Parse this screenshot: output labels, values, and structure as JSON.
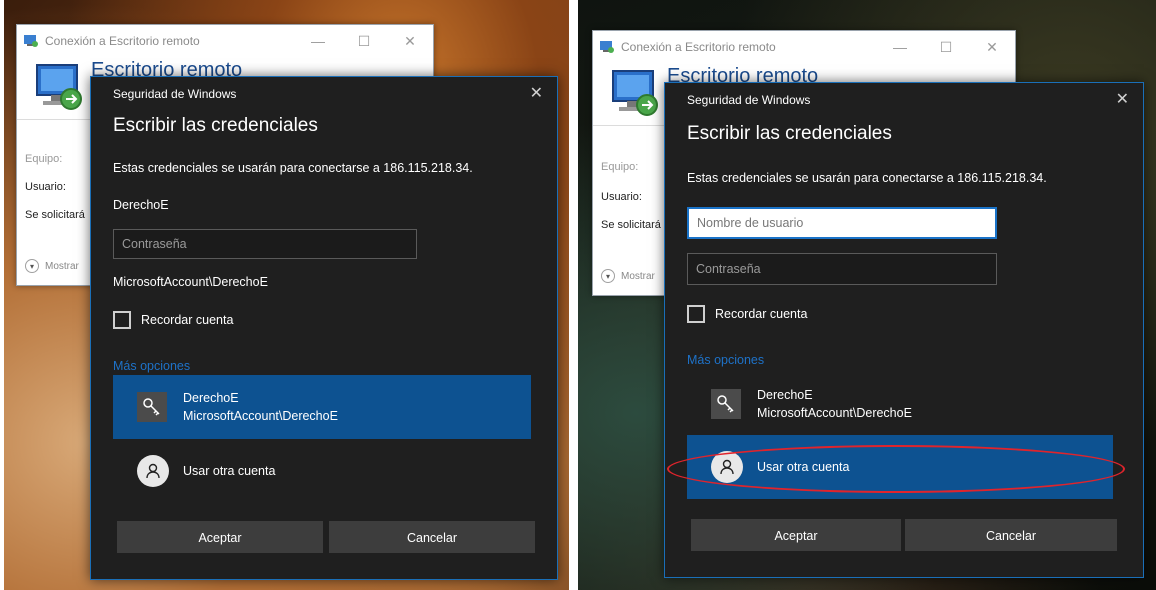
{
  "rdp": {
    "title": "Conexión a Escritorio remoto",
    "banner_title": "Escritorio remoto",
    "min_glyph": "—",
    "max_glyph": "☐",
    "close_glyph": "✕",
    "equipo_label": "Equipo:",
    "usuario_label": "Usuario:",
    "solicitara_label": "Se solicitará",
    "show_options": "Mostrar"
  },
  "dialog": {
    "header": "Seguridad de Windows",
    "close_glyph": "✕",
    "heading": "Escribir las credenciales",
    "description": "Estas credenciales se usarán para conectarse a 186.115.218.34.",
    "left_username": "DerechoE",
    "username_placeholder": "Nombre de usuario",
    "password_placeholder": "Contraseña",
    "account_line": "MicrosoftAccount\\DerechoE",
    "remember_label": "Recordar cuenta",
    "more_options": "Más opciones",
    "option_account_name": "DerechoE",
    "option_account_sub": "MicrosoftAccount\\DerechoE",
    "option_other": "Usar otra cuenta",
    "ok_button": "Aceptar",
    "cancel_button": "Cancelar"
  },
  "colors": {
    "accent": "#1e72c8",
    "selected": "#0d5291",
    "dialog_bg": "#1f1f1f",
    "highlight_ring": "#e0242c"
  }
}
